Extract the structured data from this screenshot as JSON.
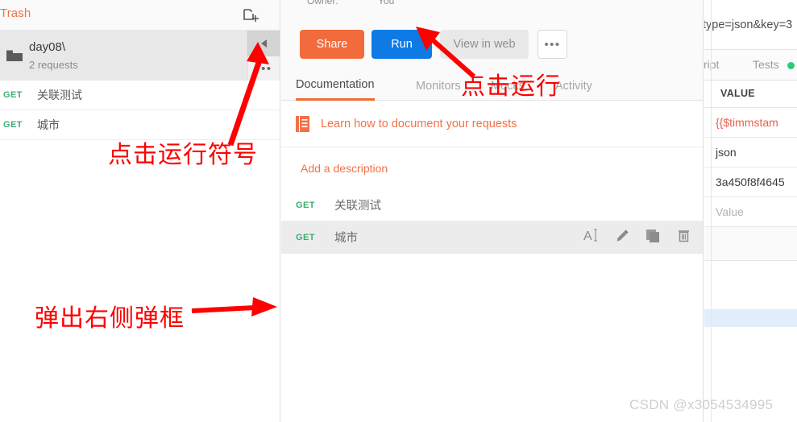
{
  "sidebar": {
    "trash_label": "Trash",
    "new_folder_icon": "new-folder-icon",
    "folder": {
      "name": "day08\\",
      "subtitle": "2 requests",
      "collapse_icon": "caret-left-icon",
      "more_icon": "ellipsis-icon"
    },
    "requests": [
      {
        "method": "GET",
        "name": "关联测试"
      },
      {
        "method": "GET",
        "name": "城市"
      }
    ]
  },
  "middle": {
    "owner_label": "Owner:",
    "owner_value": "You",
    "buttons": {
      "share": "Share",
      "run": "Run",
      "view_in_web": "View in web",
      "more": "•••"
    },
    "tabs": [
      {
        "label": "Documentation",
        "active": true
      },
      {
        "label": "Monitors",
        "active": false
      },
      {
        "label": "Mocks",
        "active": false
      },
      {
        "label": "Activity",
        "active": false
      }
    ],
    "learn_link": "Learn how to document your requests",
    "learn_icon": "book-icon",
    "add_description": "Add a description",
    "documented_requests": [
      {
        "method": "GET",
        "name": "关联测试",
        "hovered": false
      },
      {
        "method": "GET",
        "name": "城市",
        "hovered": true
      }
    ],
    "row_actions": [
      {
        "icon": "text-cursor-icon",
        "name": "rename-action"
      },
      {
        "icon": "pencil-icon",
        "name": "edit-action"
      },
      {
        "icon": "copy-icon",
        "name": "duplicate-action"
      },
      {
        "icon": "trash-icon",
        "name": "delete-action"
      }
    ]
  },
  "right": {
    "url_fragment": "type=json&key=3",
    "subtabs": [
      {
        "label": "cript",
        "full": "Pre-request Script",
        "status_dot": false
      },
      {
        "label": "Tests",
        "full": "Tests",
        "status_dot": true
      }
    ],
    "status_dot_color": "#2ecb7a",
    "table_header_value": "VALUE",
    "value_rows": [
      {
        "text": "{{$timmstam",
        "style": "var"
      },
      {
        "text": "json",
        "style": "normal"
      },
      {
        "text": "3a450f8f4645",
        "style": "normal"
      },
      {
        "text": "Value",
        "style": "placeholder"
      }
    ]
  },
  "annotations": [
    {
      "text": "点击运行符号",
      "name": "annotation-click-run-symbol"
    },
    {
      "text": "点击运行",
      "name": "annotation-click-run"
    },
    {
      "text": "弹出右侧弹框",
      "name": "annotation-popup-right-panel"
    }
  ],
  "watermark": "CSDN @x3054534995",
  "colors": {
    "brand_orange": "#f2714a",
    "run_blue": "#0e7ae6",
    "method_green": "#3dad72",
    "annotation_red": "#fe0000"
  }
}
